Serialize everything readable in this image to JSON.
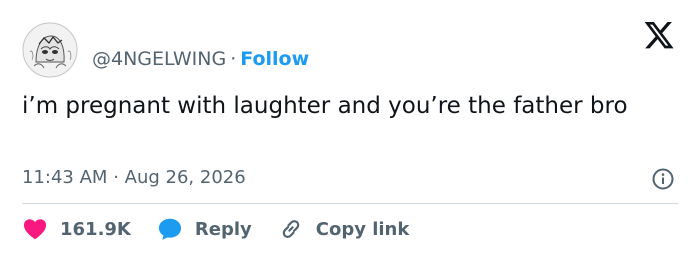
{
  "tweet": {
    "author_handle": "@4NGELWING",
    "separator": "·",
    "follow_label": "Follow",
    "text": "i’m pregnant with laughter and you’re the father bro",
    "time": "11:43 AM",
    "time_separator": "·",
    "date": "Aug 26, 2026"
  },
  "actions": {
    "like_count": "161.9K",
    "reply_label": "Reply",
    "copy_link_label": "Copy link"
  },
  "icons": {
    "logo": "x-logo-icon",
    "info": "info-icon",
    "like": "heart-icon",
    "reply": "speech-bubble-icon",
    "copy_link": "link-icon"
  },
  "colors": {
    "accent": "#1d9bf0",
    "like": "#f91880",
    "text": "#0f1419",
    "muted": "#536471",
    "divider": "#cfd9de"
  }
}
